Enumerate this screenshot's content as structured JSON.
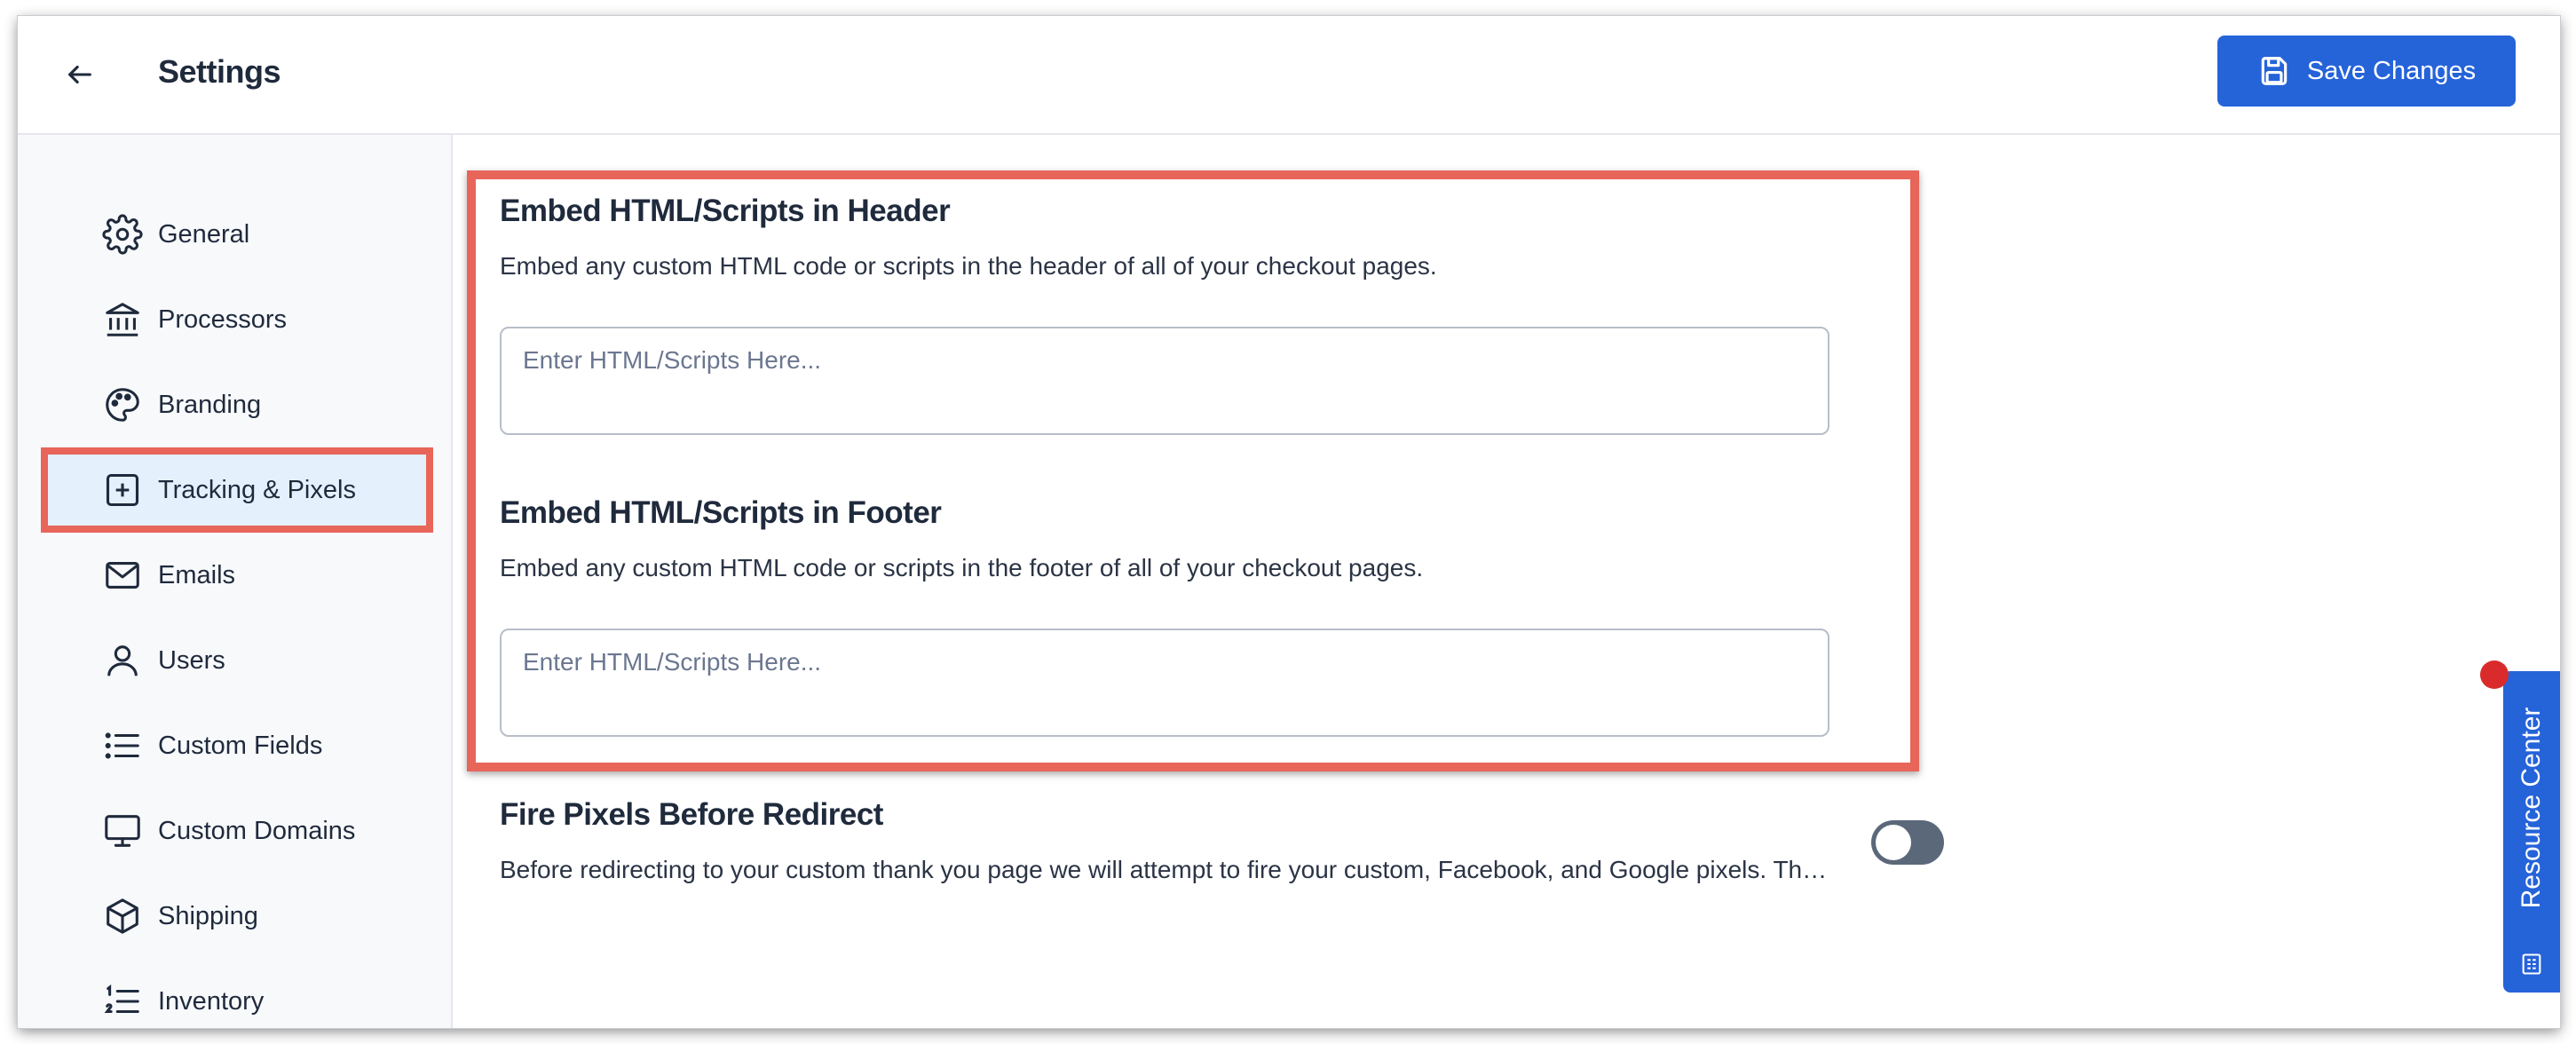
{
  "header": {
    "title": "Settings",
    "save_label": "Save Changes"
  },
  "sidebar": {
    "items": [
      {
        "label": "General",
        "icon": "gear-icon"
      },
      {
        "label": "Processors",
        "icon": "bank-icon"
      },
      {
        "label": "Branding",
        "icon": "palette-icon"
      },
      {
        "label": "Tracking & Pixels",
        "icon": "plus-square-icon",
        "active": true
      },
      {
        "label": "Emails",
        "icon": "mail-icon"
      },
      {
        "label": "Users",
        "icon": "user-icon"
      },
      {
        "label": "Custom Fields",
        "icon": "list-icon"
      },
      {
        "label": "Custom Domains",
        "icon": "monitor-icon"
      },
      {
        "label": "Shipping",
        "icon": "box-icon"
      },
      {
        "label": "Inventory",
        "icon": "numbered-list-icon"
      }
    ]
  },
  "main": {
    "header_section": {
      "title": "Embed HTML/Scripts in Header",
      "description": "Embed any custom HTML code or scripts in the header of all of your checkout pages.",
      "placeholder": "Enter HTML/Scripts Here...",
      "value": ""
    },
    "footer_section": {
      "title": "Embed HTML/Scripts in Footer",
      "description": "Embed any custom HTML code or scripts in the footer of all of your checkout pages.",
      "placeholder": "Enter HTML/Scripts Here...",
      "value": ""
    },
    "fire_pixels": {
      "title": "Fire Pixels Before Redirect",
      "description": "Before redirecting to your custom thank you page we will attempt to fire your custom, Facebook, and Google pixels. Th…",
      "enabled": false
    }
  },
  "resource_center": {
    "label": "Resource Center"
  },
  "colors": {
    "accent": "#2563d9",
    "highlight": "#e8655a",
    "active_bg": "#e4f0fc",
    "notification": "#d92b2b"
  }
}
